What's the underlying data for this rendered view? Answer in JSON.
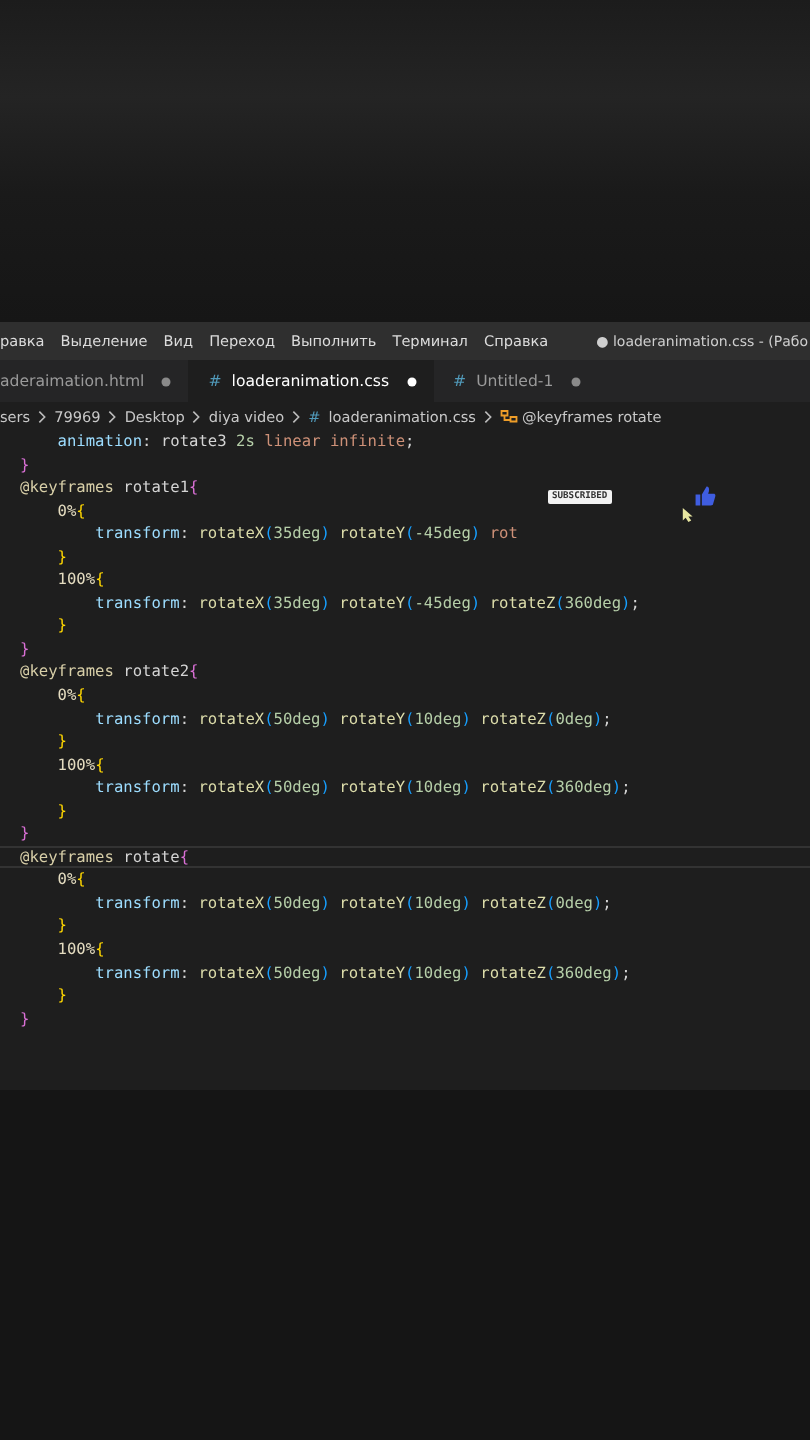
{
  "menu": [
    "равка",
    "Выделение",
    "Вид",
    "Переход",
    "Выполнить",
    "Терминал",
    "Справка"
  ],
  "window_title": "● loaderanimation.css - (Рабо",
  "tabs": [
    {
      "label": "aderaimation.html",
      "selected": false,
      "modified": true
    },
    {
      "icon": "#",
      "label": "loaderanimation.css",
      "selected": true,
      "modified": true
    },
    {
      "icon": "#",
      "label": "Untitled-1",
      "selected": false,
      "modified": true
    }
  ],
  "breadcrumb": [
    {
      "kind": "folder",
      "label": "sers"
    },
    {
      "kind": "folder",
      "label": "79969"
    },
    {
      "kind": "folder",
      "label": "Desktop"
    },
    {
      "kind": "folder",
      "label": "diya video"
    },
    {
      "kind": "file",
      "icon": "#",
      "label": "loaderanimation.css"
    },
    {
      "kind": "symbol",
      "label": "@keyframes rotate"
    }
  ],
  "code": [
    {
      "text": "    animation: rotate3 2s linear infinite;",
      "current": false
    },
    {
      "text": "}",
      "current": false
    },
    {
      "text": "@keyframes rotate1{",
      "current": false
    },
    {
      "text": "    0%{",
      "current": false
    },
    {
      "text": "        transform: rotateX(35deg) rotateY(-45deg) rot",
      "current": false
    },
    {
      "text": "    }",
      "current": false
    },
    {
      "text": "    100%{",
      "current": false
    },
    {
      "text": "        transform: rotateX(35deg) rotateY(-45deg) rotateZ(360deg);",
      "current": false
    },
    {
      "text": "    }",
      "current": false
    },
    {
      "text": "}",
      "current": false
    },
    {
      "text": "@keyframes rotate2{",
      "current": false
    },
    {
      "text": "    0%{",
      "current": false
    },
    {
      "text": "        transform: rotateX(50deg) rotateY(10deg) rotateZ(0deg);",
      "current": false
    },
    {
      "text": "    }",
      "current": false
    },
    {
      "text": "    100%{",
      "current": false
    },
    {
      "text": "        transform: rotateX(50deg) rotateY(10deg) rotateZ(360deg);",
      "current": false
    },
    {
      "text": "    }",
      "current": false
    },
    {
      "text": "}",
      "current": false
    },
    {
      "text": "@keyframes rotate{",
      "current": true
    },
    {
      "text": "    0%{",
      "current": false
    },
    {
      "text": "        transform: rotateX(50deg) rotateY(10deg) rotateZ(0deg);",
      "current": false
    },
    {
      "text": "    }",
      "current": false
    },
    {
      "text": "    100%{",
      "current": false
    },
    {
      "text": "        transform: rotateX(50deg) rotateY(10deg) rotateZ(360deg);",
      "current": false
    },
    {
      "text": "    }",
      "current": false
    },
    {
      "text": "}",
      "current": false
    }
  ],
  "overlay": {
    "badge": "SUBSCRIBED"
  }
}
